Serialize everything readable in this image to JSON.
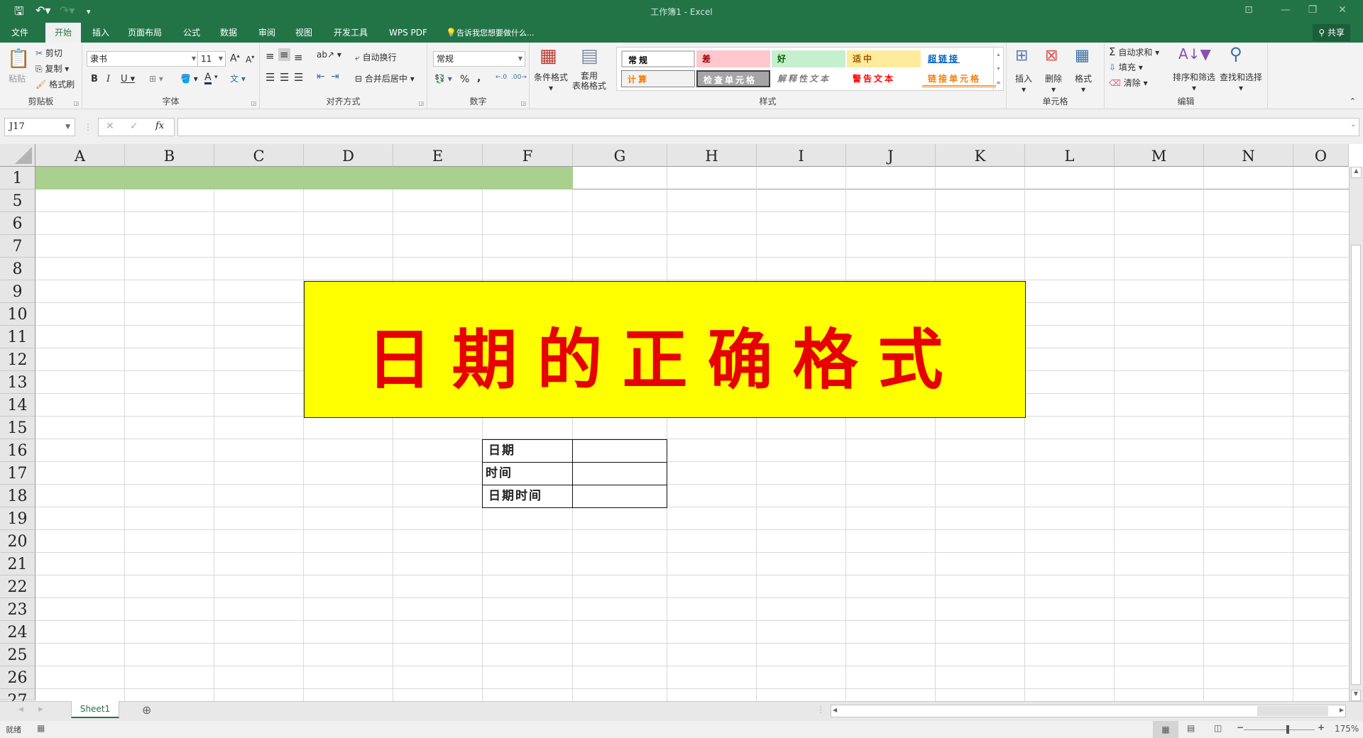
{
  "window": {
    "title": "工作簿1 - Excel",
    "share_label": "共享"
  },
  "qat": {
    "save_icon": "save-icon",
    "undo_icon": "undo-icon",
    "redo_icon": "redo-icon",
    "customize_icon": "customize-icon"
  },
  "tabs": [
    "文件",
    "开始",
    "插入",
    "页面布局",
    "公式",
    "数据",
    "审阅",
    "视图",
    "开发工具",
    "WPS PDF"
  ],
  "active_tab": "开始",
  "tell_me": "告诉我您想要做什么...",
  "ribbon": {
    "clipboard": {
      "paste": "粘贴",
      "cut": "剪切",
      "copy": "复制",
      "format_painter": "格式刷",
      "label": "剪贴板"
    },
    "font": {
      "name": "隶书",
      "size": "11",
      "bold": "B",
      "italic": "I",
      "underline": "U",
      "phonetic": "文",
      "label": "字体"
    },
    "alignment": {
      "wrap": "自动换行",
      "merge": "合并后居中",
      "label": "对齐方式"
    },
    "number": {
      "format": "常规",
      "percent": "%",
      "comma": ",",
      "label": "数字"
    },
    "styles": {
      "conditional": "条件格式",
      "table_format": "套用\n表格格式",
      "cells": [
        {
          "label": "常规",
          "bg": "#ffffff",
          "color": "#000000"
        },
        {
          "label": "差",
          "bg": "#ffc7ce",
          "color": "#9c0006"
        },
        {
          "label": "好",
          "bg": "#c6efce",
          "color": "#006100"
        },
        {
          "label": "适中",
          "bg": "#ffeb9c",
          "color": "#9c5700"
        },
        {
          "label": "超链接",
          "bg": "#ffffff",
          "color": "#0563c1"
        },
        {
          "label": "计算",
          "bg": "#f2f2f2",
          "color": "#fa7d00"
        },
        {
          "label": "检查单元格",
          "bg": "#a5a5a5",
          "color": "#ffffff"
        },
        {
          "label": "解释性文本",
          "bg": "#ffffff",
          "color": "#7f7f7f"
        },
        {
          "label": "警告文本",
          "bg": "#ffffff",
          "color": "#ff0000"
        },
        {
          "label": "链接单元格",
          "bg": "#ffffff",
          "color": "#fa7d00"
        }
      ],
      "label": "样式"
    },
    "cells_group": {
      "insert": "插入",
      "delete": "删除",
      "format": "格式",
      "label": "单元格"
    },
    "editing": {
      "autosum": "自动求和",
      "fill": "填充",
      "clear": "清除",
      "sort_filter": "排序和筛选",
      "find_select": "查找和选择",
      "label": "编辑"
    }
  },
  "formula_bar": {
    "name_box": "J17",
    "fx": "fx",
    "value": ""
  },
  "columns": [
    "A",
    "B",
    "C",
    "D",
    "E",
    "F",
    "G",
    "H",
    "I",
    "J",
    "K",
    "L",
    "M",
    "N",
    "O"
  ],
  "rows": [
    "1",
    "5",
    "6",
    "7",
    "8",
    "9",
    "10",
    "11",
    "12",
    "13",
    "14",
    "15",
    "16",
    "17",
    "18",
    "19",
    "20",
    "21",
    "22",
    "23",
    "24",
    "25",
    "26",
    "27"
  ],
  "sheet": {
    "header_fill_color": "#a9d08e",
    "banner": {
      "text": "日期的正确格式",
      "bg": "#ffff00",
      "color": "#e60000"
    },
    "table": [
      {
        "label": "日期",
        "value": ""
      },
      {
        "label": "时间",
        "value": ""
      },
      {
        "label": "日期时间",
        "value": ""
      }
    ]
  },
  "sheet_tabs": [
    "Sheet1"
  ],
  "status": {
    "ready": "就绪",
    "zoom": "175%"
  }
}
